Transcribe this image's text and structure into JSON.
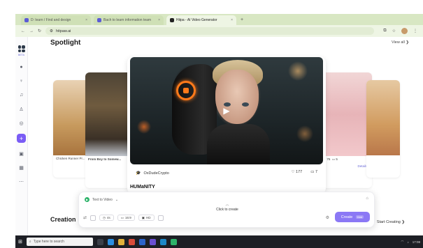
{
  "browser": {
    "tabs": [
      {
        "label": "D: learn / Find and design"
      },
      {
        "label": "Bach to learn information team"
      },
      {
        "label": "Hitpa - AI Video Generator"
      }
    ],
    "address": "hitpaw.ai"
  },
  "sidebar": {
    "logo_text": "BETA",
    "items": [
      "compass-icon",
      "bulb-icon",
      "bell-icon",
      "user-icon",
      "check-icon",
      "plus-icon",
      "image-icon",
      "grid-icon",
      "more-icon"
    ]
  },
  "spotlight": {
    "title": "Spotlight",
    "view_all": "View all ❯"
  },
  "side_cards": {
    "left_caption_1": "Chicken Runner Pr...",
    "left_caption_2": "From Boy to Somew...",
    "right_stats_likes": "76",
    "right_stats_comments": "5",
    "right_details": "Details ›"
  },
  "featured": {
    "author": "OxDudeCrypto",
    "likes": "177",
    "comments": "7",
    "title": "HUMaNITY"
  },
  "prompt_bar": {
    "mode_label": "Text to Video",
    "click_to_create": "Click to create",
    "chips": [
      "4s",
      "16:9",
      "HD"
    ],
    "create_label": "Create",
    "create_badge": "free"
  },
  "creation": {
    "title": "Creation",
    "start_creating": "Start Creating ❯"
  },
  "taskbar": {
    "search_placeholder": "Type here to search",
    "time": "17:08"
  }
}
